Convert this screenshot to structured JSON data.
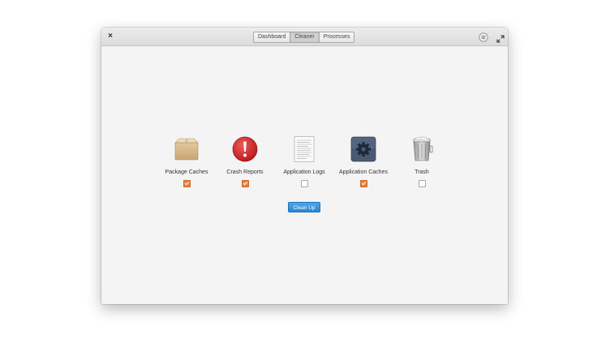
{
  "titlebar": {
    "close_glyph": "×",
    "modes": [
      {
        "label": "Dashboard",
        "active": false
      },
      {
        "label": "Cleaner",
        "active": true
      },
      {
        "label": "Processes",
        "active": false
      }
    ],
    "menu_icon": "app-menu-icon",
    "fullscreen_icon": "maximize-icon"
  },
  "cleaner": {
    "items": [
      {
        "label": "Package Caches",
        "icon": "package-box-icon",
        "checked": true
      },
      {
        "label": "Crash Reports",
        "icon": "error-alert-icon",
        "checked": true
      },
      {
        "label": "Application Logs",
        "icon": "text-document-icon",
        "checked": false
      },
      {
        "label": "Application Caches",
        "icon": "settings-gear-icon",
        "checked": true
      },
      {
        "label": "Trash",
        "icon": "trash-can-icon",
        "checked": false
      }
    ],
    "cleanup_label": "Clean Up"
  },
  "colors": {
    "accent_blue": "#3a96de",
    "checkbox_orange": "#e8823a",
    "window_bg": "#f4f4f4"
  }
}
